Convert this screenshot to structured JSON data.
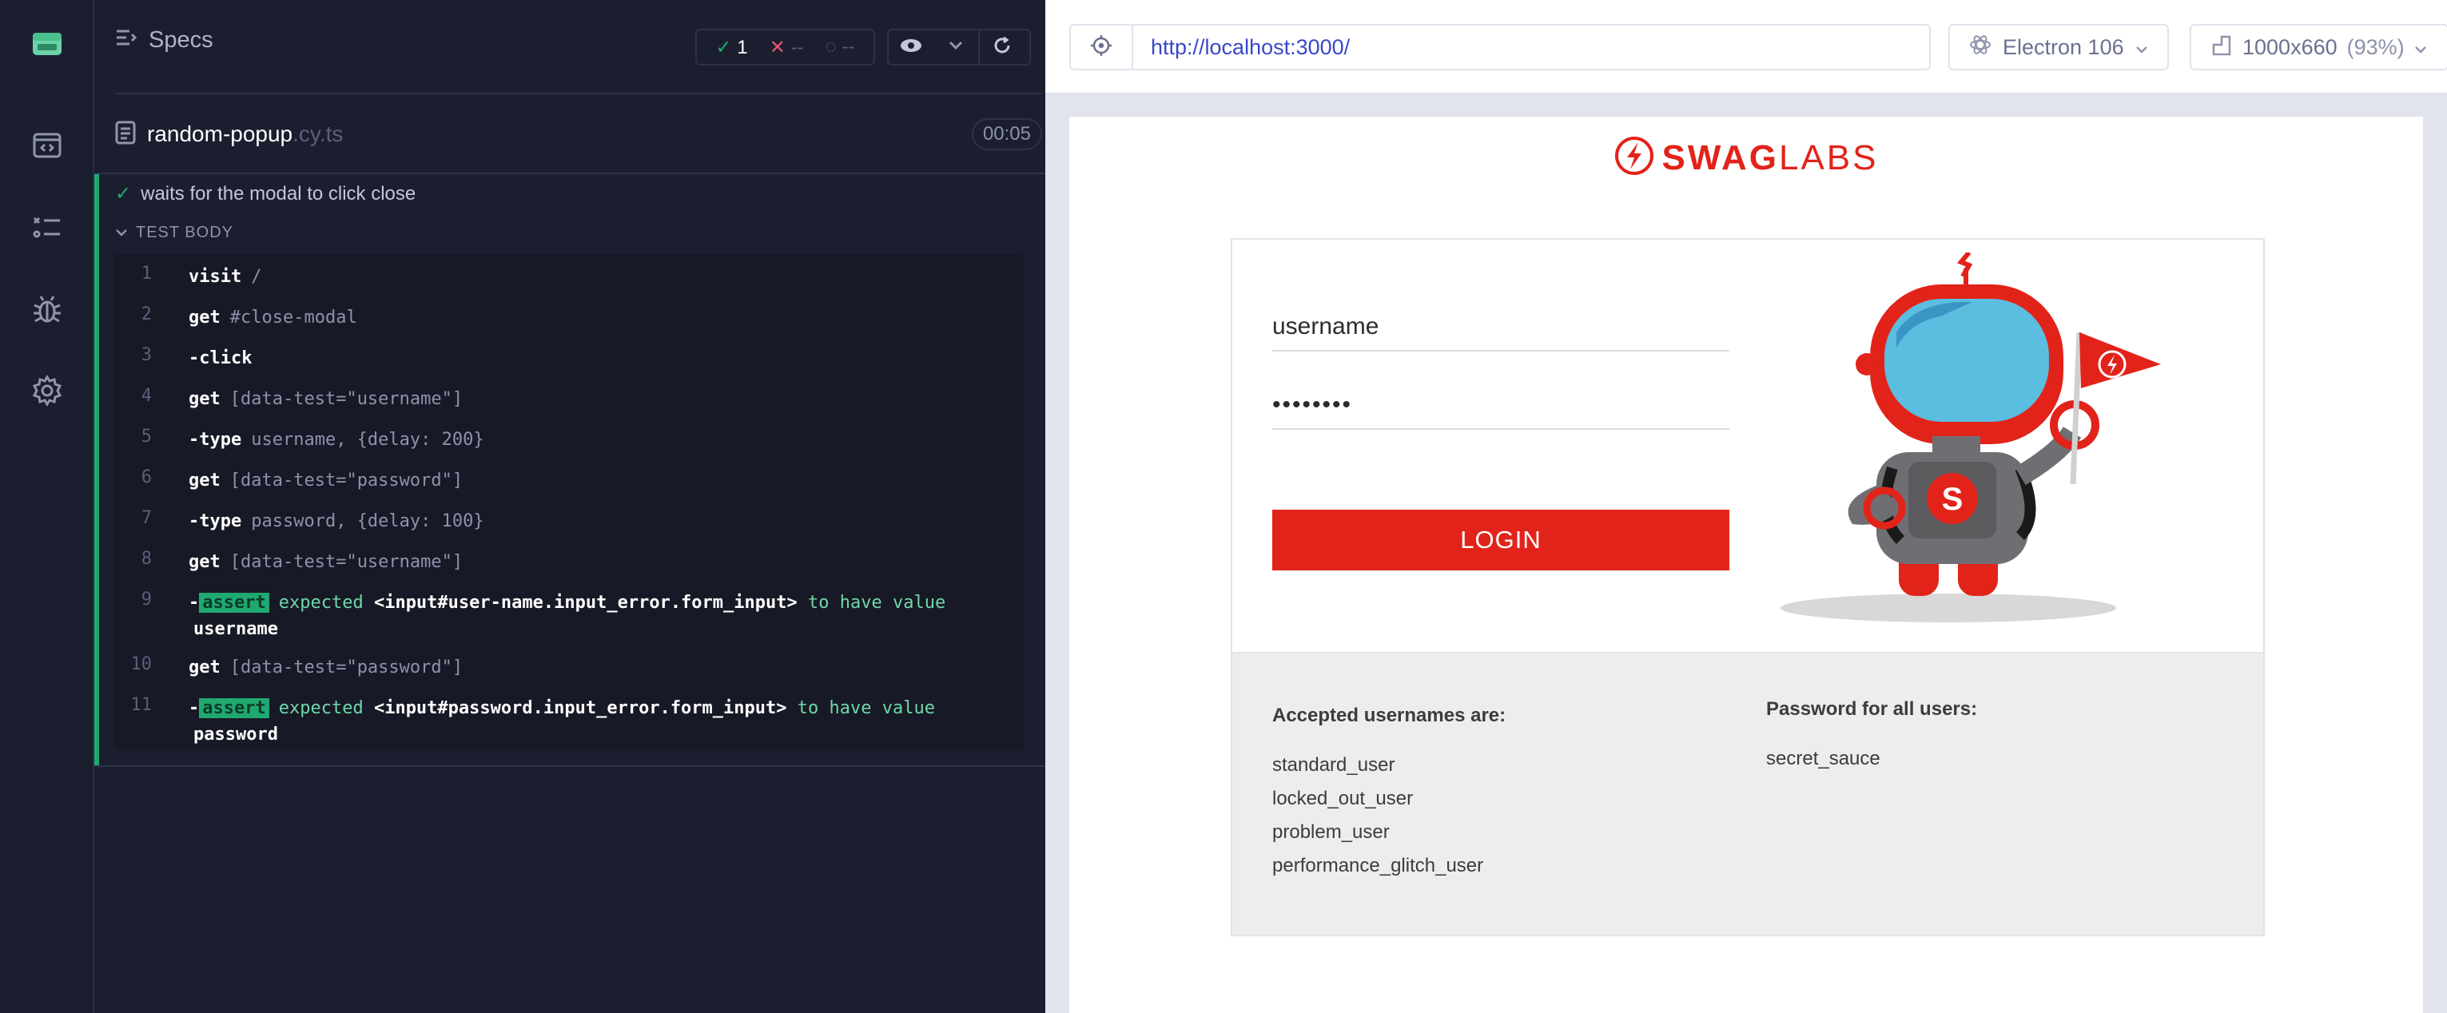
{
  "reporter": {
    "specs_label": "Specs",
    "stats": {
      "passed": "1",
      "failed": "--",
      "pending": "--"
    },
    "spec": {
      "name": "random-popup",
      "ext": ".cy.ts",
      "duration": "00:05"
    },
    "test": {
      "title": "waits for the modal to click close",
      "body_label": "TEST BODY"
    },
    "commands": [
      {
        "num": "1",
        "prefix": "",
        "name": "visit",
        "msg": "/"
      },
      {
        "num": "2",
        "prefix": "",
        "name": "get",
        "msg": "#close-modal"
      },
      {
        "num": "3",
        "prefix": "-",
        "name": "click",
        "msg": ""
      },
      {
        "num": "4",
        "prefix": "",
        "name": "get",
        "msg": "[data-test=\"username\"]"
      },
      {
        "num": "5",
        "prefix": "-",
        "name": "type",
        "msg": "username, {delay: 200}"
      },
      {
        "num": "6",
        "prefix": "",
        "name": "get",
        "msg": "[data-test=\"password\"]"
      },
      {
        "num": "7",
        "prefix": "-",
        "name": "type",
        "msg": "password, {delay: 100}"
      },
      {
        "num": "8",
        "prefix": "",
        "name": "get",
        "msg": "[data-test=\"username\"]"
      },
      {
        "num": "9",
        "prefix": "-",
        "badge": "assert",
        "expected": "expected",
        "subject": "<input#user-name.input_error.form_input>",
        "to": "to have value",
        "value": "username"
      },
      {
        "num": "10",
        "prefix": "",
        "name": "get",
        "msg": "[data-test=\"password\"]"
      },
      {
        "num": "11",
        "prefix": "-",
        "badge": "assert",
        "expected": "expected",
        "subject": "<input#password.input_error.form_input>",
        "to": "to have value",
        "value": "password"
      }
    ]
  },
  "aut_bar": {
    "url": "http://localhost:3000/",
    "browser": "Electron 106",
    "viewport": "1000x660",
    "zoom": "(93%)"
  },
  "app": {
    "logo_left": "SWAG",
    "logo_right": "LABS",
    "username_value": "username",
    "password_value": "••••••••",
    "login_label": "LOGIN",
    "accepted_title": "Accepted usernames are:",
    "usernames": [
      "standard_user",
      "locked_out_user",
      "problem_user",
      "performance_glitch_user"
    ],
    "password_title": "Password for all users:",
    "password": "secret_sauce"
  },
  "colors": {
    "brand_red": "#e2231a",
    "pass_green": "#1fa971",
    "reporter_bg": "#1b1e2e",
    "url_blue": "#3a47c9"
  }
}
